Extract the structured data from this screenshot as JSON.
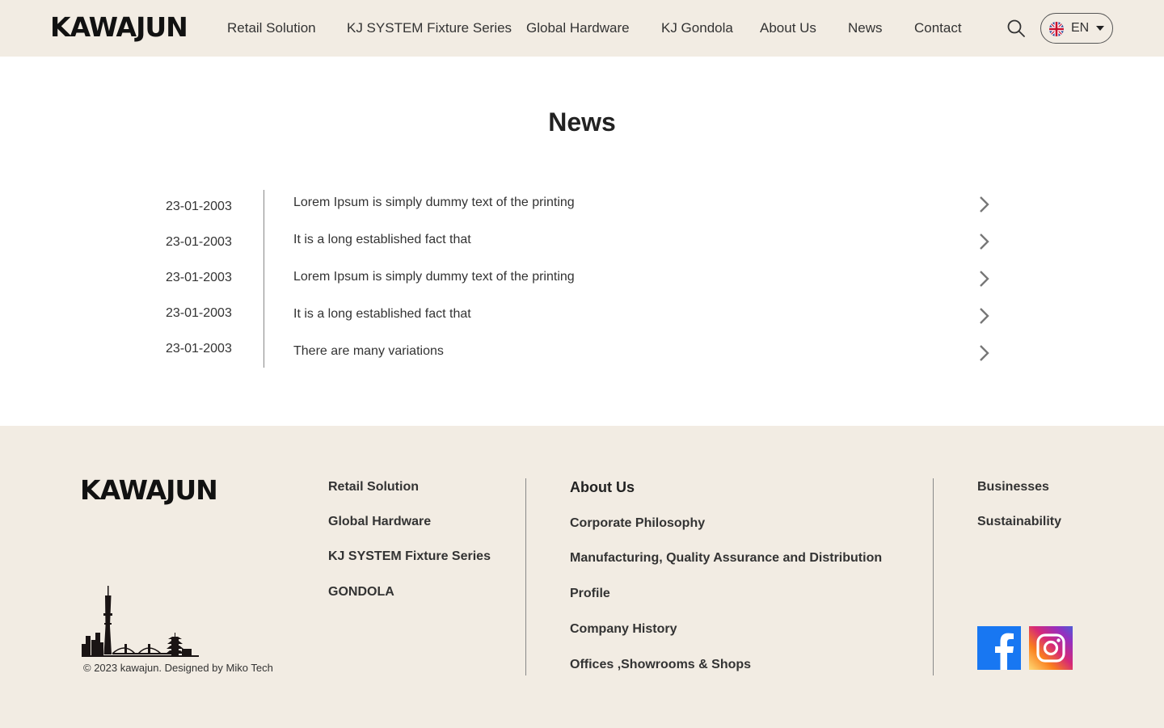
{
  "header": {
    "logo": "KAWAJUN",
    "nav": [
      "Retail Solution",
      "KJ SYSTEM Fixture Series",
      "Global Hardware",
      "KJ Gondola",
      "About Us",
      "News",
      "Contact"
    ],
    "language": "EN"
  },
  "main": {
    "title": "News",
    "items": [
      {
        "date": "23-01-2003",
        "title": "Lorem Ipsum is simply dummy text of the printing"
      },
      {
        "date": "23-01-2003",
        "title": "It is a long established fact that"
      },
      {
        "date": "23-01-2003",
        "title": "Lorem Ipsum is simply dummy text of the printing"
      },
      {
        "date": "23-01-2003",
        "title": "It is a long established fact that"
      },
      {
        "date": "23-01-2003",
        "title": "There are many variations"
      }
    ]
  },
  "footer": {
    "logo": "KAWAJUN",
    "copyright": "© 2023 kawajun. Designed by Miko Tech",
    "col1": [
      "Retail Solution",
      "Global Hardware",
      "KJ SYSTEM Fixture Series",
      "GONDOLA"
    ],
    "col2_heading": "About Us",
    "col2": [
      "Corporate Philosophy",
      "Manufacturing, Quality Assurance and Distribution",
      "Profile",
      "Company History",
      "Offices ,Showrooms & Shops"
    ],
    "col3": [
      "Businesses",
      "Sustainability"
    ],
    "social": [
      "facebook-icon",
      "instagram-icon"
    ]
  },
  "colors": {
    "header_bg": "#f2ece3",
    "footer_bg": "#f2ece3",
    "text": "#333333",
    "facebook": "#1877f2"
  }
}
